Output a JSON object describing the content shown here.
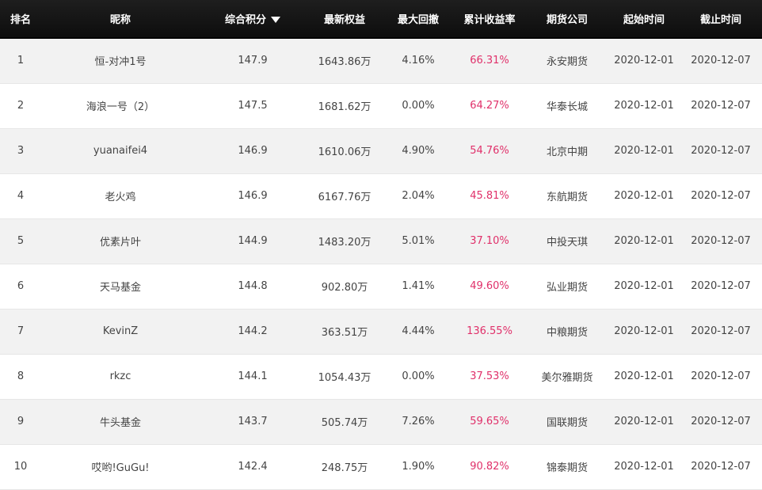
{
  "accent_color": "#e0306a",
  "sort_icon": "sort-desc-icon",
  "columns": [
    {
      "key": "rank",
      "label": "排名"
    },
    {
      "key": "name",
      "label": "昵称"
    },
    {
      "key": "score",
      "label": "综合积分",
      "sorted": "desc"
    },
    {
      "key": "equity",
      "label": "最新权益"
    },
    {
      "key": "drawdown",
      "label": "最大回撤"
    },
    {
      "key": "return",
      "label": "累计收益率"
    },
    {
      "key": "broker",
      "label": "期货公司"
    },
    {
      "key": "start",
      "label": "起始时间"
    },
    {
      "key": "end",
      "label": "截止时间"
    }
  ],
  "rows": [
    {
      "rank": "1",
      "name": "恒-对冲1号",
      "score": "147.9",
      "equity": "1643.86万",
      "drawdown": "4.16%",
      "return": "66.31%",
      "broker": "永安期货",
      "start": "2020-12-01",
      "end": "2020-12-07"
    },
    {
      "rank": "2",
      "name": "海浪一号（2）",
      "score": "147.5",
      "equity": "1681.62万",
      "drawdown": "0.00%",
      "return": "64.27%",
      "broker": "华泰长城",
      "start": "2020-12-01",
      "end": "2020-12-07"
    },
    {
      "rank": "3",
      "name": "yuanaifei4",
      "score": "146.9",
      "equity": "1610.06万",
      "drawdown": "4.90%",
      "return": "54.76%",
      "broker": "北京中期",
      "start": "2020-12-01",
      "end": "2020-12-07"
    },
    {
      "rank": "4",
      "name": "老火鸡",
      "score": "146.9",
      "equity": "6167.76万",
      "drawdown": "2.04%",
      "return": "45.81%",
      "broker": "东航期货",
      "start": "2020-12-01",
      "end": "2020-12-07"
    },
    {
      "rank": "5",
      "name": "优素片叶",
      "score": "144.9",
      "equity": "1483.20万",
      "drawdown": "5.01%",
      "return": "37.10%",
      "broker": "中投天琪",
      "start": "2020-12-01",
      "end": "2020-12-07"
    },
    {
      "rank": "6",
      "name": "天马基金",
      "score": "144.8",
      "equity": "902.80万",
      "drawdown": "1.41%",
      "return": "49.60%",
      "broker": "弘业期货",
      "start": "2020-12-01",
      "end": "2020-12-07"
    },
    {
      "rank": "7",
      "name": "KevinZ",
      "score": "144.2",
      "equity": "363.51万",
      "drawdown": "4.44%",
      "return": "136.55%",
      "broker": "中粮期货",
      "start": "2020-12-01",
      "end": "2020-12-07"
    },
    {
      "rank": "8",
      "name": "rkzc",
      "score": "144.1",
      "equity": "1054.43万",
      "drawdown": "0.00%",
      "return": "37.53%",
      "broker": "美尔雅期货",
      "start": "2020-12-01",
      "end": "2020-12-07"
    },
    {
      "rank": "9",
      "name": "牛头基金",
      "score": "143.7",
      "equity": "505.74万",
      "drawdown": "7.26%",
      "return": "59.65%",
      "broker": "国联期货",
      "start": "2020-12-01",
      "end": "2020-12-07"
    },
    {
      "rank": "10",
      "name": "哎哟!GuGu!",
      "score": "142.4",
      "equity": "248.75万",
      "drawdown": "1.90%",
      "return": "90.82%",
      "broker": "锦泰期货",
      "start": "2020-12-01",
      "end": "2020-12-07"
    }
  ]
}
